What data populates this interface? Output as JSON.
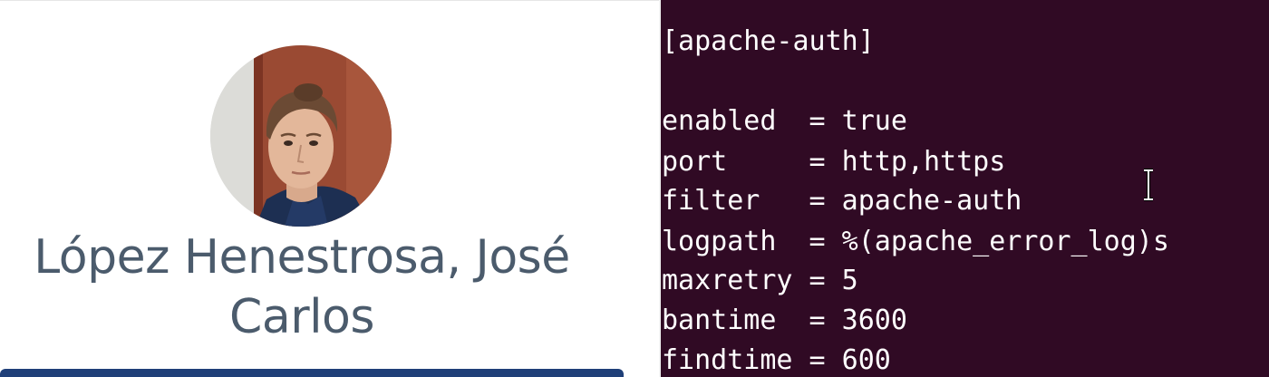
{
  "profile": {
    "name_line1": "López Henestrosa, José",
    "name_line2": "Carlos",
    "avatar_icon": "profile-photo"
  },
  "terminal": {
    "background": "#300a24",
    "text_color": "#ffffff",
    "lines": [
      "[apache-auth]",
      "",
      "enabled  = true",
      "port     = http,https",
      "filter   = apache-auth",
      "logpath  = %(apache_error_log)s",
      "maxretry = 5",
      "bantime  = 3600",
      "findtime = 600"
    ],
    "cursor_icon": "text-cursor-icon"
  },
  "colors": {
    "name_text": "#4b5b6c",
    "profile_bar": "#1f3f78"
  }
}
